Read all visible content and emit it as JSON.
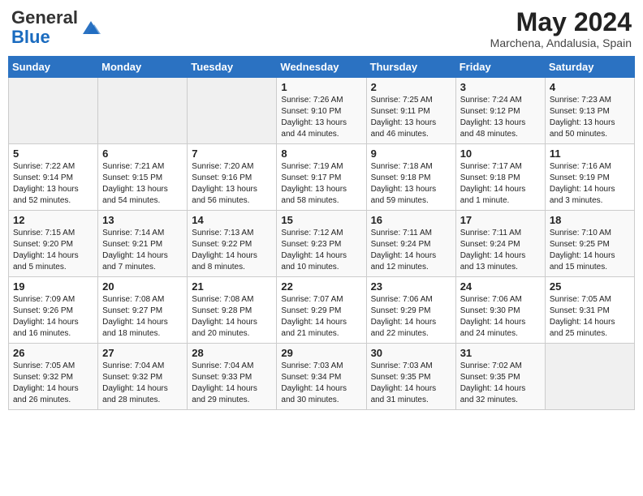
{
  "header": {
    "logo_general": "General",
    "logo_blue": "Blue",
    "month_year": "May 2024",
    "location": "Marchena, Andalusia, Spain"
  },
  "weekdays": [
    "Sunday",
    "Monday",
    "Tuesday",
    "Wednesday",
    "Thursday",
    "Friday",
    "Saturday"
  ],
  "weeks": [
    [
      {
        "day": "",
        "info": ""
      },
      {
        "day": "",
        "info": ""
      },
      {
        "day": "",
        "info": ""
      },
      {
        "day": "1",
        "info": "Sunrise: 7:26 AM\nSunset: 9:10 PM\nDaylight: 13 hours\nand 44 minutes."
      },
      {
        "day": "2",
        "info": "Sunrise: 7:25 AM\nSunset: 9:11 PM\nDaylight: 13 hours\nand 46 minutes."
      },
      {
        "day": "3",
        "info": "Sunrise: 7:24 AM\nSunset: 9:12 PM\nDaylight: 13 hours\nand 48 minutes."
      },
      {
        "day": "4",
        "info": "Sunrise: 7:23 AM\nSunset: 9:13 PM\nDaylight: 13 hours\nand 50 minutes."
      }
    ],
    [
      {
        "day": "5",
        "info": "Sunrise: 7:22 AM\nSunset: 9:14 PM\nDaylight: 13 hours\nand 52 minutes."
      },
      {
        "day": "6",
        "info": "Sunrise: 7:21 AM\nSunset: 9:15 PM\nDaylight: 13 hours\nand 54 minutes."
      },
      {
        "day": "7",
        "info": "Sunrise: 7:20 AM\nSunset: 9:16 PM\nDaylight: 13 hours\nand 56 minutes."
      },
      {
        "day": "8",
        "info": "Sunrise: 7:19 AM\nSunset: 9:17 PM\nDaylight: 13 hours\nand 58 minutes."
      },
      {
        "day": "9",
        "info": "Sunrise: 7:18 AM\nSunset: 9:18 PM\nDaylight: 13 hours\nand 59 minutes."
      },
      {
        "day": "10",
        "info": "Sunrise: 7:17 AM\nSunset: 9:18 PM\nDaylight: 14 hours\nand 1 minute."
      },
      {
        "day": "11",
        "info": "Sunrise: 7:16 AM\nSunset: 9:19 PM\nDaylight: 14 hours\nand 3 minutes."
      }
    ],
    [
      {
        "day": "12",
        "info": "Sunrise: 7:15 AM\nSunset: 9:20 PM\nDaylight: 14 hours\nand 5 minutes."
      },
      {
        "day": "13",
        "info": "Sunrise: 7:14 AM\nSunset: 9:21 PM\nDaylight: 14 hours\nand 7 minutes."
      },
      {
        "day": "14",
        "info": "Sunrise: 7:13 AM\nSunset: 9:22 PM\nDaylight: 14 hours\nand 8 minutes."
      },
      {
        "day": "15",
        "info": "Sunrise: 7:12 AM\nSunset: 9:23 PM\nDaylight: 14 hours\nand 10 minutes."
      },
      {
        "day": "16",
        "info": "Sunrise: 7:11 AM\nSunset: 9:24 PM\nDaylight: 14 hours\nand 12 minutes."
      },
      {
        "day": "17",
        "info": "Sunrise: 7:11 AM\nSunset: 9:24 PM\nDaylight: 14 hours\nand 13 minutes."
      },
      {
        "day": "18",
        "info": "Sunrise: 7:10 AM\nSunset: 9:25 PM\nDaylight: 14 hours\nand 15 minutes."
      }
    ],
    [
      {
        "day": "19",
        "info": "Sunrise: 7:09 AM\nSunset: 9:26 PM\nDaylight: 14 hours\nand 16 minutes."
      },
      {
        "day": "20",
        "info": "Sunrise: 7:08 AM\nSunset: 9:27 PM\nDaylight: 14 hours\nand 18 minutes."
      },
      {
        "day": "21",
        "info": "Sunrise: 7:08 AM\nSunset: 9:28 PM\nDaylight: 14 hours\nand 20 minutes."
      },
      {
        "day": "22",
        "info": "Sunrise: 7:07 AM\nSunset: 9:29 PM\nDaylight: 14 hours\nand 21 minutes."
      },
      {
        "day": "23",
        "info": "Sunrise: 7:06 AM\nSunset: 9:29 PM\nDaylight: 14 hours\nand 22 minutes."
      },
      {
        "day": "24",
        "info": "Sunrise: 7:06 AM\nSunset: 9:30 PM\nDaylight: 14 hours\nand 24 minutes."
      },
      {
        "day": "25",
        "info": "Sunrise: 7:05 AM\nSunset: 9:31 PM\nDaylight: 14 hours\nand 25 minutes."
      }
    ],
    [
      {
        "day": "26",
        "info": "Sunrise: 7:05 AM\nSunset: 9:32 PM\nDaylight: 14 hours\nand 26 minutes."
      },
      {
        "day": "27",
        "info": "Sunrise: 7:04 AM\nSunset: 9:32 PM\nDaylight: 14 hours\nand 28 minutes."
      },
      {
        "day": "28",
        "info": "Sunrise: 7:04 AM\nSunset: 9:33 PM\nDaylight: 14 hours\nand 29 minutes."
      },
      {
        "day": "29",
        "info": "Sunrise: 7:03 AM\nSunset: 9:34 PM\nDaylight: 14 hours\nand 30 minutes."
      },
      {
        "day": "30",
        "info": "Sunrise: 7:03 AM\nSunset: 9:35 PM\nDaylight: 14 hours\nand 31 minutes."
      },
      {
        "day": "31",
        "info": "Sunrise: 7:02 AM\nSunset: 9:35 PM\nDaylight: 14 hours\nand 32 minutes."
      },
      {
        "day": "",
        "info": ""
      }
    ]
  ]
}
